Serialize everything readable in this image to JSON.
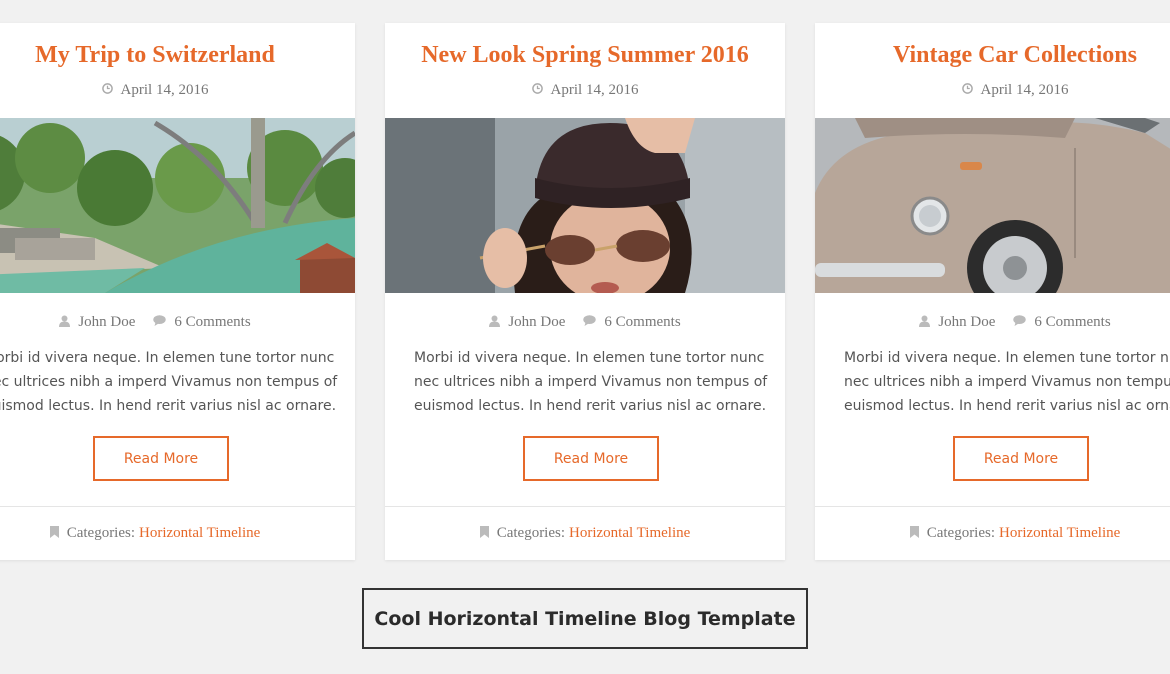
{
  "posts": [
    {
      "title": "My Trip to Switzerland",
      "date": "April 14, 2016",
      "image_icon": "switzerland-river-photo",
      "author": "John Doe",
      "comments": "6 Comments",
      "excerpt_lines": [
        "Morbi id vivera neque. In elemen tune tortor nunc",
        "nec ultrices nibh a imperd Vivamus non tempus of",
        "euismod lectus. In hend rerit varius nisl ac ornare."
      ],
      "read_more": "Read More",
      "categories_label": "Categories:",
      "category": "Horizontal Timeline"
    },
    {
      "title": "New Look Spring Summer 2016",
      "date": "April 14, 2016",
      "image_icon": "woman-sunglasses-photo",
      "author": "John Doe",
      "comments": "6 Comments",
      "excerpt_lines": [
        "Morbi id vivera neque. In elemen tune tortor nunc",
        "nec ultrices nibh a imperd Vivamus non tempus of",
        "euismod lectus. In hend rerit varius nisl ac ornare."
      ],
      "read_more": "Read More",
      "categories_label": "Categories:",
      "category": "Horizontal Timeline"
    },
    {
      "title": "Vintage Car Collections",
      "date": "April 14, 2016",
      "image_icon": "vintage-car-photo",
      "author": "John Doe",
      "comments": "6 Comments",
      "excerpt_lines": [
        "Morbi id vivera neque. In elemen tune tortor nunc",
        "nec ultrices nibh a imperd Vivamus non tempus of",
        "euismod lectus. In hend rerit varius nisl ac ornare."
      ],
      "read_more": "Read More",
      "categories_label": "Categories:",
      "category": "Horizontal Timeline"
    }
  ],
  "banner": {
    "label": "Cool Horizontal Timeline Blog Template"
  },
  "colors": {
    "accent": "#e6692a",
    "background": "#f1f1f1",
    "card": "#ffffff",
    "meta_text": "#777777",
    "body_text": "#555555"
  }
}
